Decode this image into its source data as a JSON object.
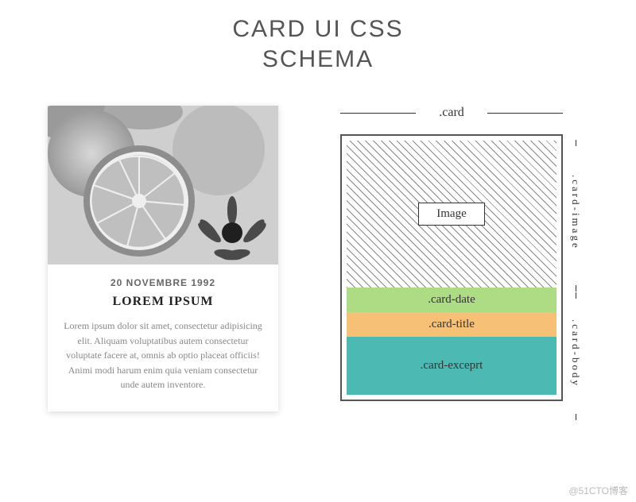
{
  "heading_line1": "CARD UI CSS",
  "heading_line2": "SCHEMA",
  "card": {
    "date": "20 NOVEMBRE 1992",
    "title": "LOREM IPSUM",
    "excerpt": "Lorem ipsum dolor sit amet, consectetur adipisicing elit. Aliquam voluptatibus autem consectetur voluptate facere at, omnis ab optio placeat officiis! Animi modi harum enim quia veniam consectetur unde autem inventore."
  },
  "schema": {
    "card_label": ".card",
    "image_label": "Image",
    "date_label": ".card-date",
    "title_label": ".card-title",
    "excerpt_label": ".card-exceprt",
    "side_image_label": ".card-image",
    "side_body_label": ".card-body"
  },
  "colors": {
    "date_bg": "#aedc85",
    "title_bg": "#f6c077",
    "excerpt_bg": "#4cbab3"
  },
  "watermark": "@51CTO博客"
}
